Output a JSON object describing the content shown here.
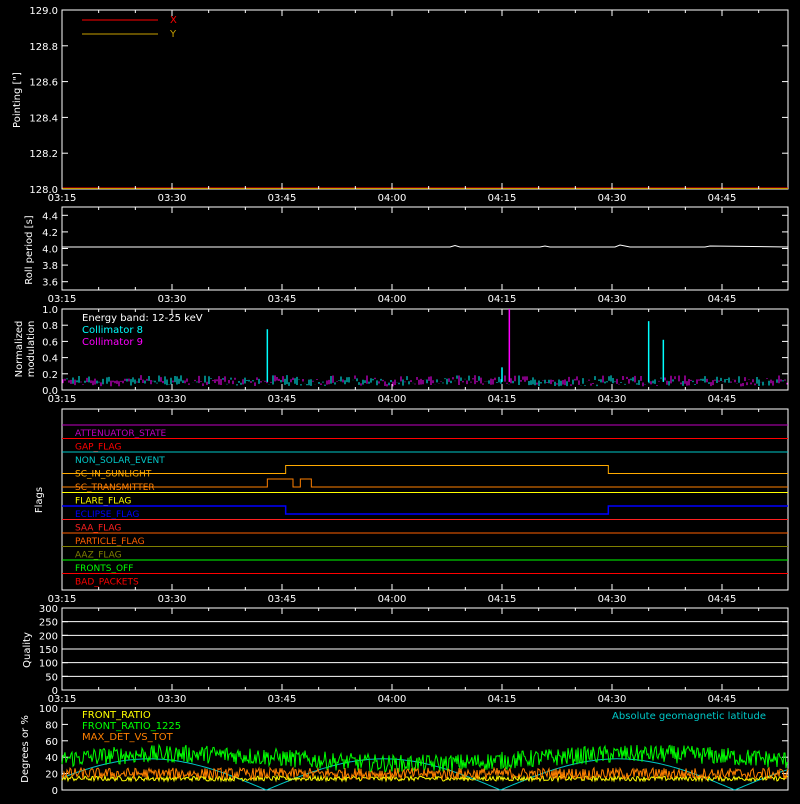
{
  "time_ticks": [
    "03:15",
    "03:30",
    "03:45",
    "04:00",
    "04:15",
    "04:30",
    "04:45"
  ],
  "chart_data": [
    {
      "id": "pointing",
      "type": "line",
      "ylabel": "Pointing [\"]",
      "ylim": [
        128.0,
        129.0
      ],
      "yticks": [
        "128.0",
        "128.2",
        "128.4",
        "128.6",
        "128.8",
        "129.0"
      ],
      "legend": [
        "X",
        "Y"
      ],
      "colors": {
        "X": "#ff0000",
        "Y": "#c8a000"
      },
      "series": [
        {
          "name": "X",
          "values": [
            128.0,
            128.0
          ]
        },
        {
          "name": "Y",
          "values": [
            128.0,
            128.0
          ]
        }
      ]
    },
    {
      "id": "roll",
      "type": "line",
      "ylabel": "Roll period [s]",
      "ylim": [
        3.5,
        4.5
      ],
      "yticks": [
        "3.6",
        "3.8",
        "4.0",
        "4.2",
        "4.4"
      ],
      "series": [
        {
          "name": "",
          "values": [
            4.0,
            4.0,
            4.0,
            4.0,
            4.0
          ]
        }
      ],
      "color": "#ffffff"
    },
    {
      "id": "modulation",
      "type": "line",
      "ylabel_line1": "Normalized",
      "ylabel_line2": "modulation",
      "ylim": [
        0.0,
        1.0
      ],
      "yticks": [
        "0.0",
        "0.2",
        "0.4",
        "0.6",
        "0.8",
        "1.0"
      ],
      "annotation": "Energy band: 12-25 keV",
      "legend": [
        "Collimator 8",
        "Collimator 9"
      ],
      "colors": {
        "Collimator 8": "#00ffff",
        "Collimator 9": "#ff00ff"
      },
      "spikes": [
        {
          "series": "Collimator 8",
          "time": "03:43",
          "value": 0.75
        },
        {
          "series": "Collimator 8",
          "time": "04:15",
          "value": 0.28
        },
        {
          "series": "Collimator 9",
          "time": "04:16",
          "value": 1.0
        },
        {
          "series": "Collimator 8",
          "time": "04:35",
          "value": 0.85
        },
        {
          "series": "Collimator 8",
          "time": "04:37",
          "value": 0.62
        }
      ],
      "baseline": 0.1
    },
    {
      "id": "flags",
      "type": "line",
      "ylabel": "Flags",
      "flags": [
        {
          "name": "ATTENUATOR_STATE",
          "color": "#c000c0"
        },
        {
          "name": "GAP_FLAG",
          "color": "#ff0000"
        },
        {
          "name": "NON_SOLAR_EVENT",
          "color": "#00c8c8"
        },
        {
          "name": "SC_IN_SUNLIGHT",
          "color": "#ffaa00"
        },
        {
          "name": "SC_TRANSMITTER",
          "color": "#ff8000"
        },
        {
          "name": "FLARE_FLAG",
          "color": "#ffff00"
        },
        {
          "name": "ECLIPSE_FLAG",
          "color": "#0000ff"
        },
        {
          "name": "SAA_FLAG",
          "color": "#ff2020"
        },
        {
          "name": "PARTICLE_FLAG",
          "color": "#ff6000"
        },
        {
          "name": "AAZ_FLAG",
          "color": "#808000"
        },
        {
          "name": "FRONTS_OFF",
          "color": "#00ff00"
        },
        {
          "name": "BAD_PACKETS",
          "color": "#ff0000"
        }
      ]
    },
    {
      "id": "quality",
      "type": "line",
      "ylabel": "Quality",
      "ylim": [
        0,
        300
      ],
      "yticks": [
        "0",
        "50",
        "100",
        "150",
        "200",
        "250",
        "300"
      ]
    },
    {
      "id": "ratios",
      "type": "line",
      "ylabel": "Degrees or %",
      "ylim": [
        0,
        100
      ],
      "yticks": [
        "0",
        "20",
        "40",
        "60",
        "80",
        "100"
      ],
      "legend": [
        "FRONT_RATIO",
        "FRONT_RATIO_1225",
        "MAX_DET_VS_TOT"
      ],
      "colors": {
        "FRONT_RATIO": "#ffff00",
        "FRONT_RATIO_1225": "#00ff00",
        "MAX_DET_VS_TOT": "#ff8000"
      },
      "right_label": "Absolute geomagnetic latitude",
      "right_color": "#00c8c8"
    }
  ]
}
